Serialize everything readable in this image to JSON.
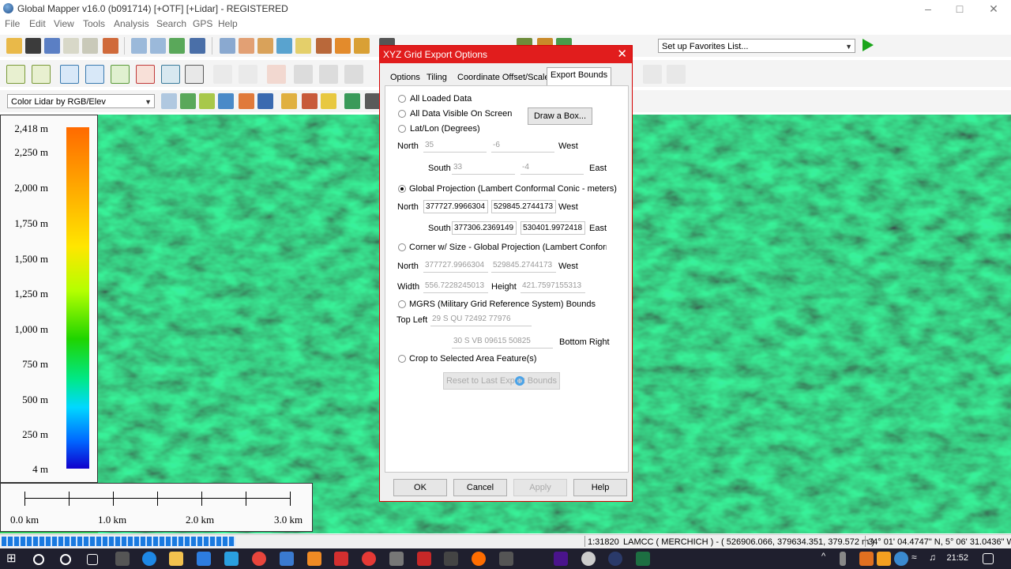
{
  "window": {
    "title": "Global Mapper v16.0 (b091714) [+OTF] [+Lidar] - REGISTERED"
  },
  "menu": [
    "File",
    "Edit",
    "View",
    "Tools",
    "Analysis",
    "Search",
    "GPS",
    "Help"
  ],
  "toolbar": {
    "favorites_select": "Set up Favorites List...",
    "shader_select": "Color Lidar by RGB/Elev"
  },
  "legend": {
    "labels": [
      "2,418 m",
      "2,250 m",
      "2,000 m",
      "1,750 m",
      "1,500 m",
      "1,250 m",
      "1,000 m",
      "750 m",
      "500 m",
      "250 m",
      "4 m"
    ]
  },
  "scalebar": {
    "labels": [
      "0.0 km",
      "1.0 km",
      "2.0 km",
      "3.0 km"
    ]
  },
  "dialog": {
    "title": "XYZ Grid Export Options",
    "tabs": [
      "Options",
      "Tiling",
      "Coordinate Offset/Scale",
      "Export Bounds"
    ],
    "all_loaded": "All Loaded Data",
    "all_visible": "All Data Visible On Screen",
    "draw_box": "Draw a Box...",
    "latlon": "Lat/Lon (Degrees)",
    "north": "North",
    "south": "South",
    "west": "West",
    "east": "East",
    "latlon_north": "35",
    "latlon_west": "-6",
    "latlon_south": "33",
    "latlon_east": "-4",
    "global_proj": "Global Projection (Lambert Conformal Conic - meters)",
    "gp_north": "377727.9966304",
    "gp_west": "529845.2744173",
    "gp_south": "377306.2369149",
    "gp_east": "530401.9972418",
    "corner_size": "Corner w/ Size - Global Projection (Lambert Conformal Cc",
    "cs_north": "377727.9966304",
    "cs_west": "529845.2744173",
    "width": "Width",
    "height": "Height",
    "cs_width": "556.7228245013",
    "cs_height": "421.7597155313",
    "mgrs": "MGRS (Military Grid Reference System) Bounds",
    "top_left": "Top Left",
    "mgrs_top_left": "29 S QU 72492 77976",
    "mgrs_bottom_right": "30 S VB 09615 50825",
    "bottom_right": "Bottom Right",
    "crop": "Crop to Selected Area Feature(s)",
    "reset_bounds": "Reset to Last Export Bounds",
    "ok": "OK",
    "cancel": "Cancel",
    "apply": "Apply",
    "help": "Help"
  },
  "status": {
    "scale": "1:31820",
    "projection": "LAMCC ( MERCHICH ) - ( 526906.066, 379634.351, 379.572 m )",
    "coords": "34° 01' 04.4747\" N, 5° 06' 31.0436\" W"
  },
  "taskbar": {
    "time": "21:52"
  },
  "colors": {
    "dialog_title": "#e11d1d",
    "map_green": "#22c44f",
    "progress": "#1a7ae0"
  }
}
